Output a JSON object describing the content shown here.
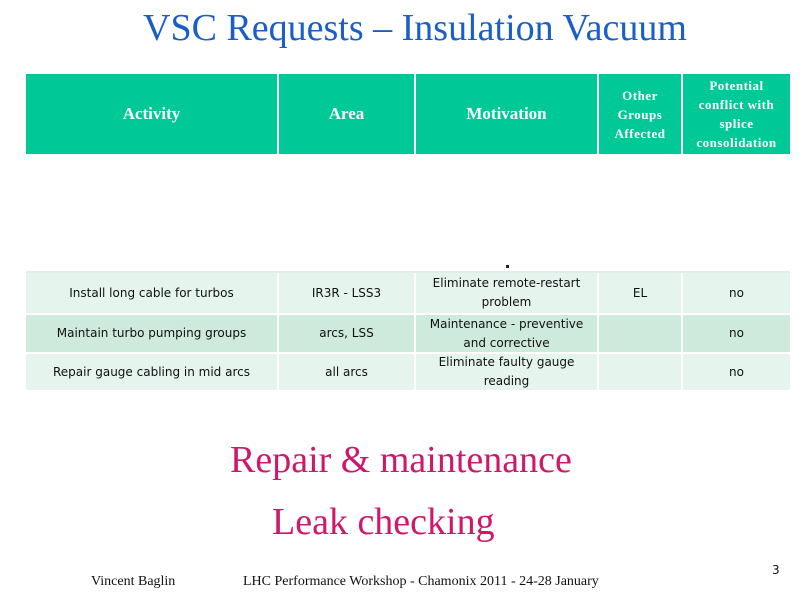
{
  "slide": {
    "title": "VSC Requests – Insulation Vacuum",
    "table": {
      "headers": [
        "Activity",
        "Area",
        "Motivation",
        "Other Groups Affected",
        "Potential conflict with splice consolidation"
      ],
      "rows": [
        {
          "activity": "Install long cable for turbos",
          "area": "IR3R - LSS3",
          "motivation": "Eliminate remote-restart problem",
          "other_groups": "EL",
          "conflict": "no"
        },
        {
          "activity": "Maintain turbo pumping groups",
          "area": "arcs, LSS",
          "motivation": "Maintenance - preventive and corrective",
          "other_groups": "",
          "conflict": "no"
        },
        {
          "activity": "Repair gauge cabling in mid arcs",
          "area": "all arcs",
          "motivation": "Eliminate faulty gauge reading",
          "other_groups": "",
          "conflict": "no"
        }
      ]
    },
    "highlight_1": "Repair & maintenance",
    "highlight_2": "Leak checking",
    "footer": {
      "author": "Vincent Baglin",
      "event": "LHC Performance Workshop - Chamonix 2011 - 24-28 January",
      "page_number": "3"
    },
    "colors": {
      "title": "#1a5fc8",
      "header_bg": "#00c896",
      "highlight": "#d0186a",
      "row_light": "#e6f4ee",
      "row_dark": "#cdeadd"
    }
  }
}
